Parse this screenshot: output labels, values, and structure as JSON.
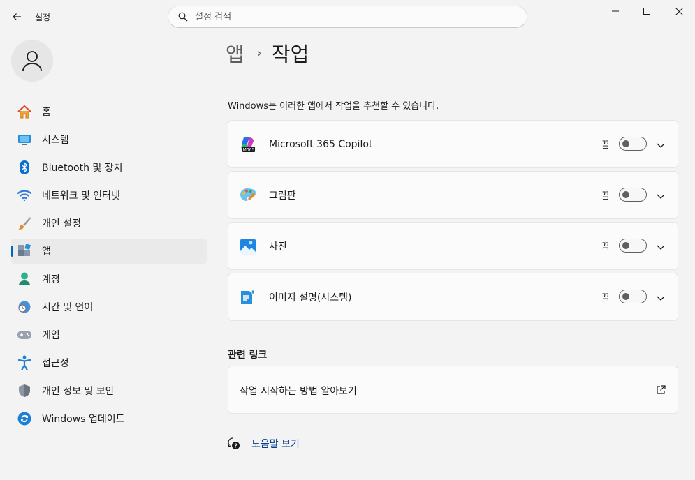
{
  "window": {
    "title": "설정",
    "controls": [
      "minimize-icon",
      "maximize-icon",
      "close-icon"
    ]
  },
  "search": {
    "placeholder": "설정 검색",
    "value": ""
  },
  "sidebar": {
    "items": [
      {
        "label": "홈",
        "icon": "home-icon"
      },
      {
        "label": "시스템",
        "icon": "system-icon"
      },
      {
        "label": "Bluetooth 및 장치",
        "icon": "bluetooth-icon"
      },
      {
        "label": "네트워크 및 인터넷",
        "icon": "wifi-icon"
      },
      {
        "label": "개인 설정",
        "icon": "brush-icon"
      },
      {
        "label": "앱",
        "icon": "apps-icon",
        "active": true
      },
      {
        "label": "계정",
        "icon": "account-icon"
      },
      {
        "label": "시간 및 언어",
        "icon": "clock-globe-icon"
      },
      {
        "label": "게임",
        "icon": "gamepad-icon"
      },
      {
        "label": "접근성",
        "icon": "accessibility-icon"
      },
      {
        "label": "개인 정보 및 보안",
        "icon": "shield-icon"
      },
      {
        "label": "Windows 업데이트",
        "icon": "windows-update-icon"
      }
    ]
  },
  "main": {
    "breadcrumb": {
      "parent": "앱",
      "separator": "›",
      "current": "작업"
    },
    "intro": "Windows는 이러한 앱에서 작업을 추천할 수 있습니다.",
    "actions": [
      {
        "label": "Microsoft 365 Copilot",
        "state": "끔",
        "enabled": false,
        "icon": "m365-copilot-icon"
      },
      {
        "label": "그림판",
        "state": "끔",
        "enabled": false,
        "icon": "paint-icon"
      },
      {
        "label": "사진",
        "state": "끔",
        "enabled": false,
        "icon": "photos-icon"
      },
      {
        "label": "이미지 설명(시스템)",
        "state": "끔",
        "enabled": false,
        "icon": "image-description-icon"
      }
    ],
    "related": {
      "title": "관련 링크",
      "link_label": "작업 시작하는 방법 알아보기"
    },
    "help_label": "도움말 보기"
  },
  "colors": {
    "accent": "#0067c0",
    "background": "#f3f3f3",
    "card": "#fbfbfb",
    "link": "#003e92"
  }
}
